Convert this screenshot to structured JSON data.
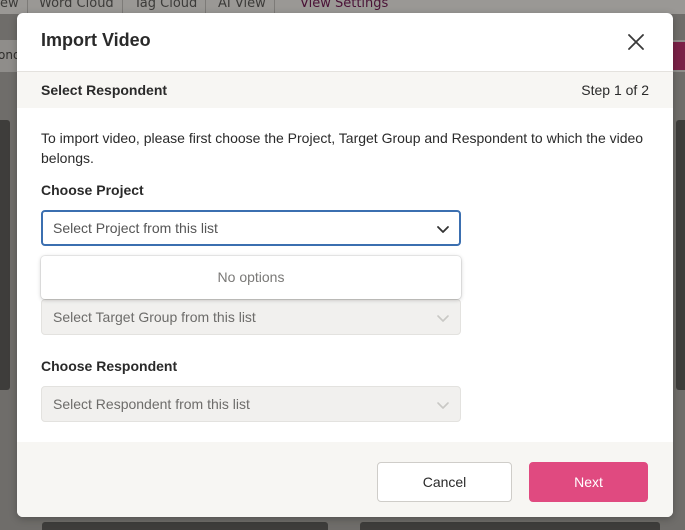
{
  "background": {
    "tabs": [
      "ew",
      "Word Cloud",
      "Tag Cloud",
      "AI View",
      "View Settings"
    ],
    "toolbar_text": "ond"
  },
  "modal": {
    "title": "Import Video",
    "close_icon": "close-icon",
    "step": {
      "title": "Select Respondent",
      "count": "Step 1 of 2"
    },
    "intro": "To import video, please first choose the Project, Target Group and Respondent to which the video belongs.",
    "project": {
      "label": "Choose Project",
      "placeholder": "Select Project from this list",
      "menu_empty": "No options"
    },
    "target_group": {
      "placeholder": "Select Target Group from this list"
    },
    "respondent": {
      "label": "Choose Respondent",
      "placeholder": "Select Respondent from this list"
    },
    "footer": {
      "cancel_label": "Cancel",
      "next_label": "Next"
    }
  },
  "colors": {
    "accent": "#e04a80",
    "focus": "#3b6fb0",
    "footer_bg": "#f7f6f3"
  }
}
